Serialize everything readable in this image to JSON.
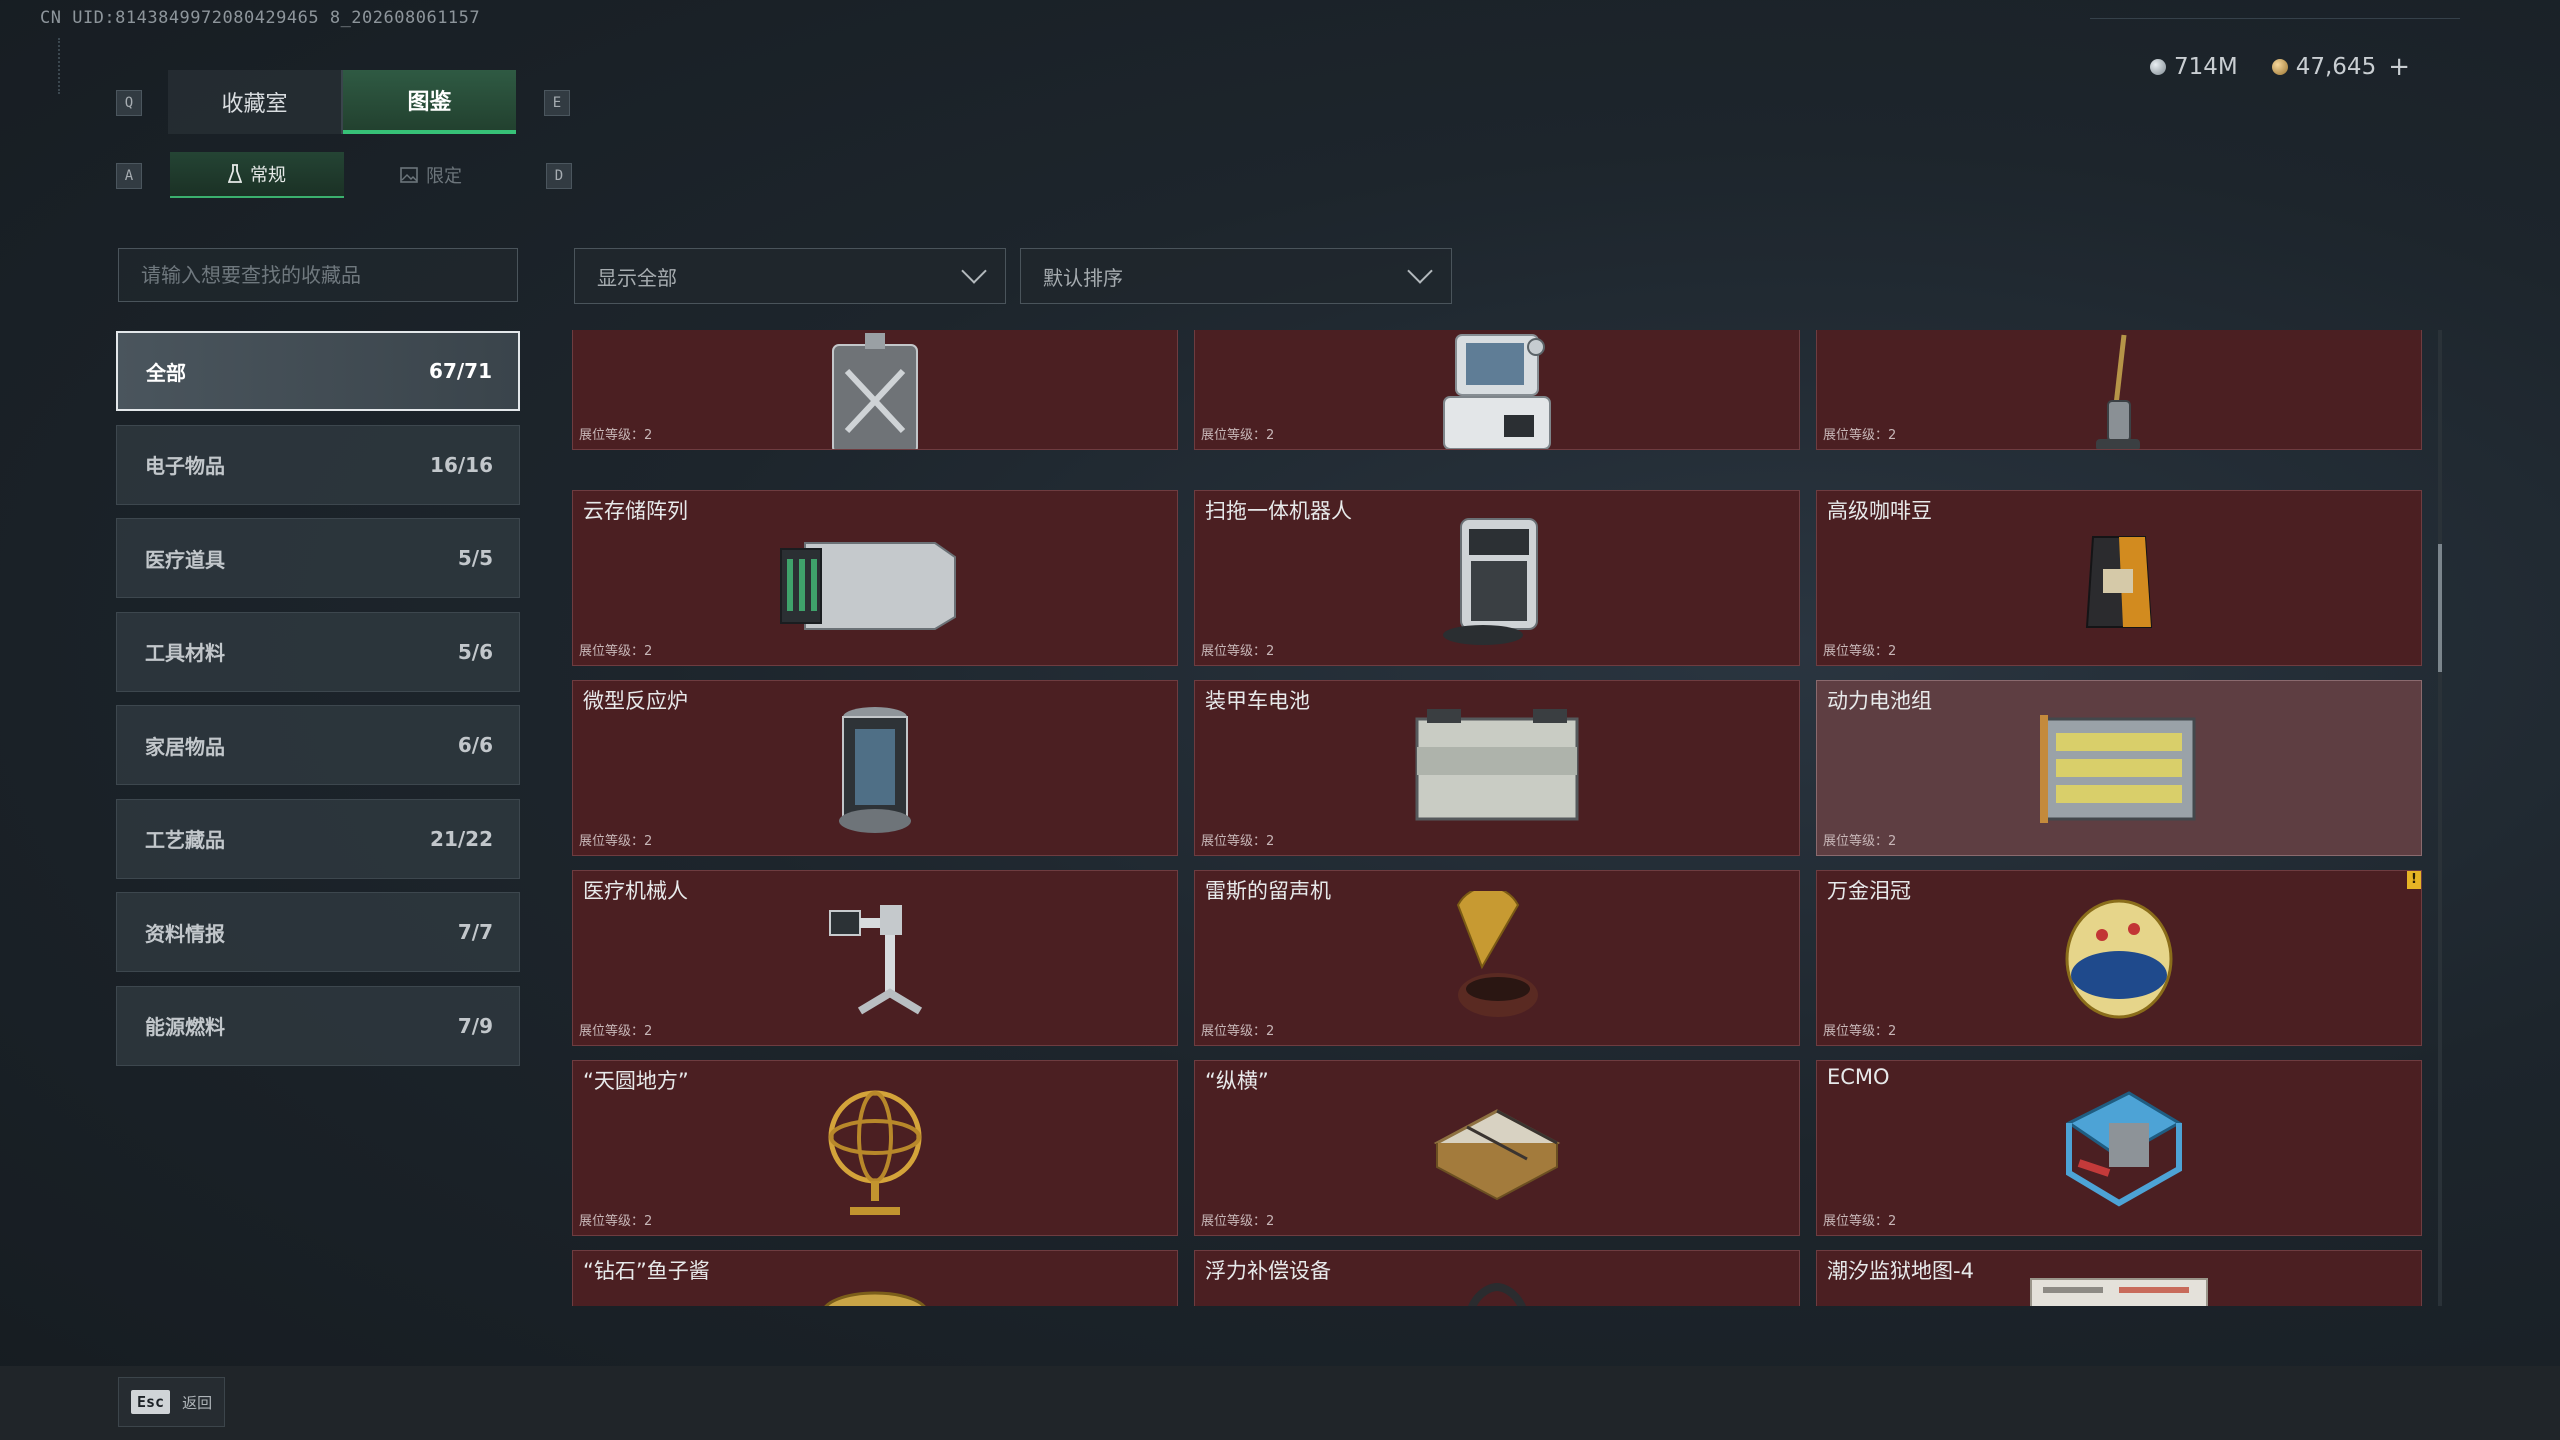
{
  "uid_text": "CN UID:8143849972080429465 8_202608061157",
  "keys": {
    "q": "Q",
    "e": "E",
    "a": "A",
    "d": "D"
  },
  "tabs": {
    "collection": "收藏室",
    "catalog": "图鉴"
  },
  "subtabs": {
    "regular": "常规",
    "limited": "限定"
  },
  "currency": {
    "silver": "714M",
    "gold": "47,645",
    "add": "+"
  },
  "search": {
    "placeholder": "请输入想要查找的收藏品"
  },
  "filter": {
    "value": "显示全部"
  },
  "sort": {
    "value": "默认排序"
  },
  "categories": [
    {
      "label": "全部",
      "count": "67/71"
    },
    {
      "label": "电子物品",
      "count": "16/16"
    },
    {
      "label": "医疗道具",
      "count": "5/5"
    },
    {
      "label": "工具材料",
      "count": "5/6"
    },
    {
      "label": "家居物品",
      "count": "6/6"
    },
    {
      "label": "工艺藏品",
      "count": "21/22"
    },
    {
      "label": "资料情报",
      "count": "7/7"
    },
    {
      "label": "能源燃料",
      "count": "7/9"
    }
  ],
  "level_label": "展位等级：2",
  "items": [
    {
      "name": ""
    },
    {
      "name": ""
    },
    {
      "name": ""
    },
    {
      "name": "云存储阵列"
    },
    {
      "name": "扫拖一体机器人"
    },
    {
      "name": "高级咖啡豆"
    },
    {
      "name": "微型反应炉"
    },
    {
      "name": "装甲车电池"
    },
    {
      "name": "动力电池组"
    },
    {
      "name": "医疗机械人"
    },
    {
      "name": "雷斯的留声机"
    },
    {
      "name": "万金泪冠",
      "badge": "!"
    },
    {
      "name": "“天圆地方”"
    },
    {
      "name": "“纵横”"
    },
    {
      "name": "ECMO"
    },
    {
      "name": "“钻石”鱼子酱"
    },
    {
      "name": "浮力补偿设备"
    },
    {
      "name": "潮汐监狱地图-4"
    }
  ],
  "footer": {
    "esc": "Esc",
    "back": "返回"
  }
}
